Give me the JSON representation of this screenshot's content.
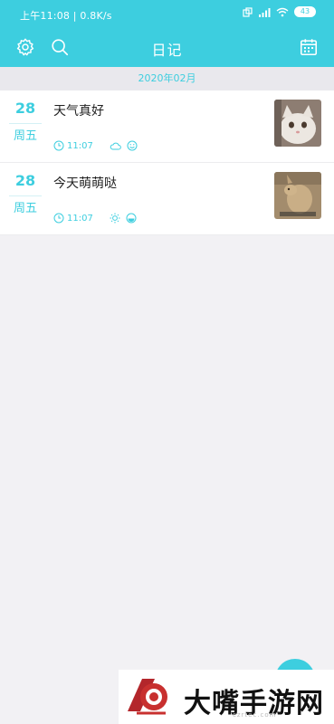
{
  "status": {
    "time": "上午11:08 | 0.8K/s",
    "battery": "43"
  },
  "header": {
    "title": "日记",
    "settings_icon": "gear-icon",
    "search_icon": "search-icon",
    "calendar_icon": "calendar-icon"
  },
  "month_label": "2020年02月",
  "entries": [
    {
      "day": "28",
      "weekday": "周五",
      "title": "天气真好",
      "time": "11:07",
      "weather_icon": "cloud-icon",
      "mood_icon": "smile-icon",
      "thumbnail": "cat-photo"
    },
    {
      "day": "28",
      "weekday": "周五",
      "title": "今天萌萌哒",
      "time": "11:07",
      "weather_icon": "sun-icon",
      "mood_icon": "neutral-face-icon",
      "thumbnail": "kangaroo-photo"
    }
  ],
  "banner": {
    "brand": "大嘴手游网",
    "url": "czrtec.com"
  },
  "colors": {
    "accent": "#3dcedf",
    "background": "#f2f1f4"
  }
}
